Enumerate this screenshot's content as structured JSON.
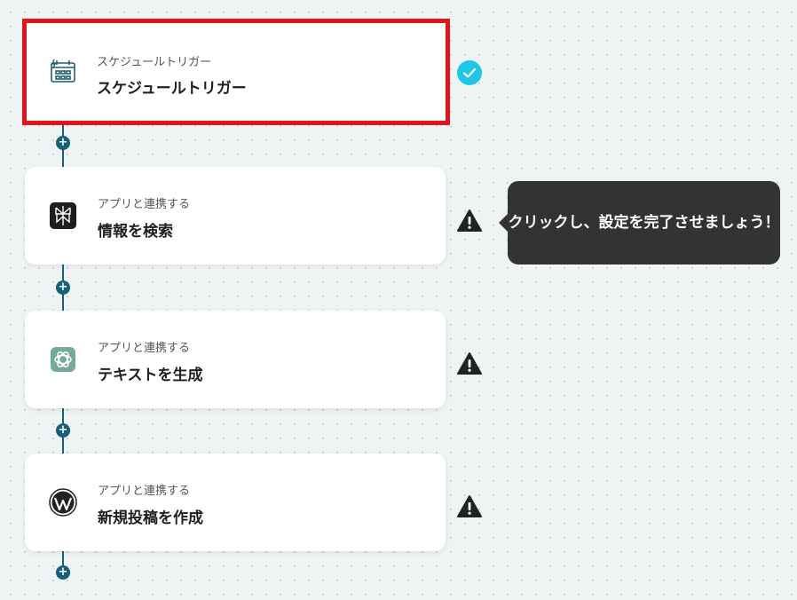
{
  "flow": {
    "steps": [
      {
        "subtitle": "スケジュールトリガー",
        "title": "スケジュールトリガー",
        "icon": "schedule-calendar-icon",
        "status": "complete"
      },
      {
        "subtitle": "アプリと連携する",
        "title": "情報を検索",
        "icon": "perplexity-icon",
        "status": "warning"
      },
      {
        "subtitle": "アプリと連携する",
        "title": "テキストを生成",
        "icon": "openai-icon",
        "status": "warning"
      },
      {
        "subtitle": "アプリと連携する",
        "title": "新規投稿を作成",
        "icon": "wordpress-icon",
        "status": "warning"
      }
    ],
    "add_symbol": "+"
  },
  "tooltip": {
    "text": "クリックし、設定を完了させましょう！"
  },
  "colors": {
    "selected_border": "#e0141a",
    "connector": "#16607a",
    "success": "#1ec7e6",
    "warning": "#222222",
    "tooltip_bg": "#333333"
  }
}
